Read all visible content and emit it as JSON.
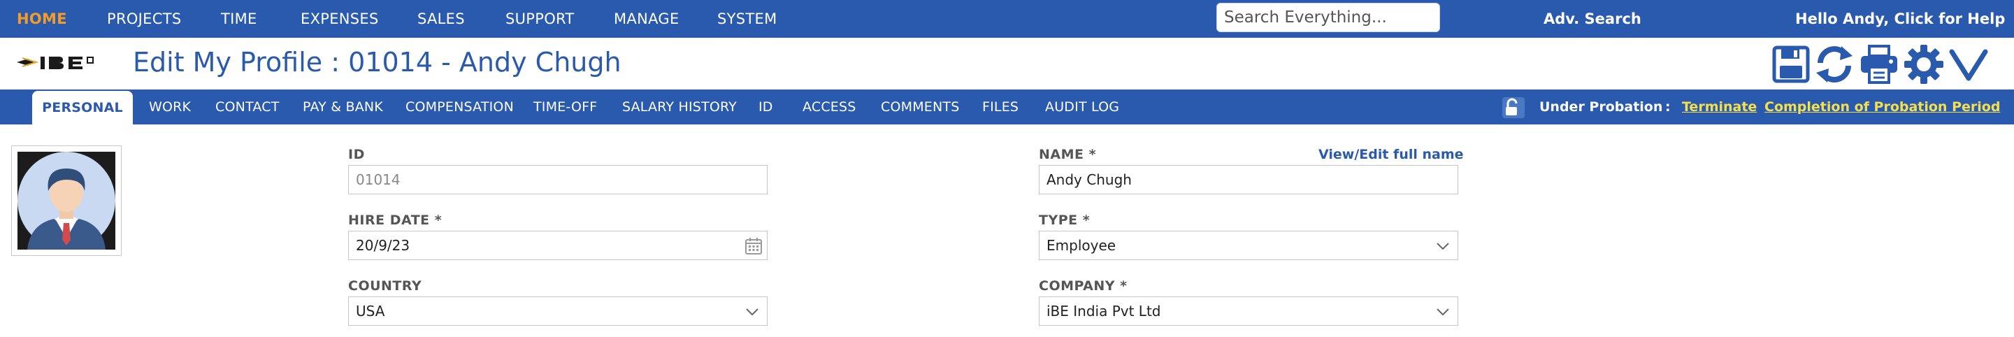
{
  "topnav": {
    "items": [
      "HOME",
      "PROJECTS",
      "TIME",
      "EXPENSES",
      "SALES",
      "SUPPORT",
      "MANAGE",
      "SYSTEM"
    ],
    "search_placeholder": "Search Everything...",
    "adv_search": "Adv. Search",
    "hello": "Hello Andy, Click for Help"
  },
  "header": {
    "title": "Edit My Profile : 01014 - Andy Chugh",
    "tools": [
      "save-icon",
      "refresh-icon",
      "print-icon",
      "gear-icon",
      "chevron-down-icon"
    ]
  },
  "tabs": [
    "PERSONAL",
    "WORK",
    "CONTACT",
    "PAY & BANK",
    "COMPENSATION",
    "TIME-OFF",
    "SALARY HISTORY",
    "ID",
    "ACCESS",
    "COMMENTS",
    "FILES",
    "AUDIT LOG"
  ],
  "probation": {
    "status": "Under Probation",
    "separator": ":",
    "terminate": "Terminate",
    "completion": "Completion of Probation Period"
  },
  "form": {
    "id_label": "ID",
    "id_value": "01014",
    "name_label": "NAME *",
    "name_value": "Andy Chugh",
    "view_edit": "View/Edit full name",
    "hire_label": "HIRE DATE *",
    "hire_value": "20/9/23",
    "type_label": "TYPE *",
    "type_value": "Employee",
    "country_label": "COUNTRY",
    "country_value": "USA",
    "company_label": "COMPANY *",
    "company_value": "iBE India Pvt Ltd"
  },
  "colors": {
    "brand_blue": "#2a5aad",
    "home_orange": "#f39c2a",
    "link_yellow": "#f4e04d"
  }
}
